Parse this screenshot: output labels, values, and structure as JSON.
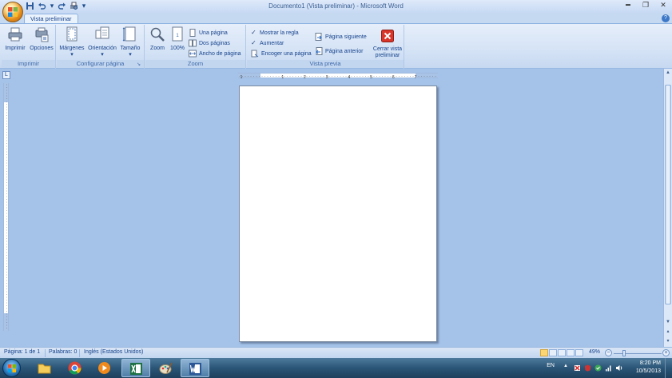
{
  "window": {
    "title": "Documento1 (Vista preliminar) - Microsoft Word",
    "minimize_glyph": "▬",
    "restore_glyph": "❐",
    "close_glyph": "✕"
  },
  "quick_access": {
    "save_icon": "save-icon",
    "undo_icon": "undo-icon",
    "redo_icon": "redo-icon",
    "print_preview_icon": "print-preview-icon",
    "customize_glyph": "▾"
  },
  "tabs": [
    {
      "label": "Vista preliminar",
      "active": true
    }
  ],
  "ribbon": {
    "groups": {
      "imprimir": {
        "label": "Imprimir",
        "buttons": [
          {
            "label": "Imprimir",
            "icon": "printer-icon"
          },
          {
            "label": "Opciones",
            "icon": "options-icon"
          }
        ]
      },
      "configurar": {
        "label": "Configurar página",
        "buttons": [
          {
            "label": "Márgenes",
            "icon": "margins-icon"
          },
          {
            "label": "Orientación",
            "icon": "orientation-icon"
          },
          {
            "label": "Tamaño",
            "icon": "size-icon"
          }
        ]
      },
      "zoom": {
        "label": "Zoom",
        "buttons": [
          {
            "label": "Zoom",
            "icon": "magnifier-icon"
          },
          {
            "label": "100%",
            "icon": "page-100-icon"
          }
        ],
        "small": [
          {
            "label": "Una página"
          },
          {
            "label": "Dos páginas"
          },
          {
            "label": "Ancho de página"
          }
        ]
      },
      "vista_previa": {
        "label": "Vista previa",
        "checks": [
          {
            "label": "Mostrar la regla",
            "checked": true
          },
          {
            "label": "Aumentar",
            "checked": true
          },
          {
            "label": "Encoger una página",
            "checked": false
          }
        ],
        "nav": [
          {
            "label": "Página siguiente"
          },
          {
            "label": "Página anterior"
          }
        ],
        "close": {
          "label_line1": "Cerrar vista",
          "label_line2": "preliminar"
        }
      }
    }
  },
  "ruler": {
    "corner_glyph": "L",
    "tick_labels": [
      "1",
      "1",
      "2",
      "3",
      "4",
      "5",
      "6",
      "7"
    ]
  },
  "status": {
    "page": "Página: 1 de 1",
    "words": "Palabras: 0",
    "language": "Inglés (Estados Unidos)",
    "zoom": "49%",
    "zoom_level": 0.49
  },
  "taskbar": {
    "apps": [
      {
        "name": "explorer",
        "icon": "folder-icon"
      },
      {
        "name": "chrome",
        "icon": "chrome-icon"
      },
      {
        "name": "media-player",
        "icon": "media-player-icon"
      },
      {
        "name": "excel",
        "icon": "excel-icon"
      },
      {
        "name": "paint",
        "icon": "paint-icon"
      },
      {
        "name": "word",
        "icon": "word-icon",
        "active": true
      }
    ],
    "language": "EN",
    "time": "8:20 PM",
    "date": "10/5/2013"
  },
  "colors": {
    "ribbon_bg": "#d5e3f6",
    "doc_bg": "#a5c2e9",
    "text": "#15428b",
    "close_red": "#d9352a"
  }
}
